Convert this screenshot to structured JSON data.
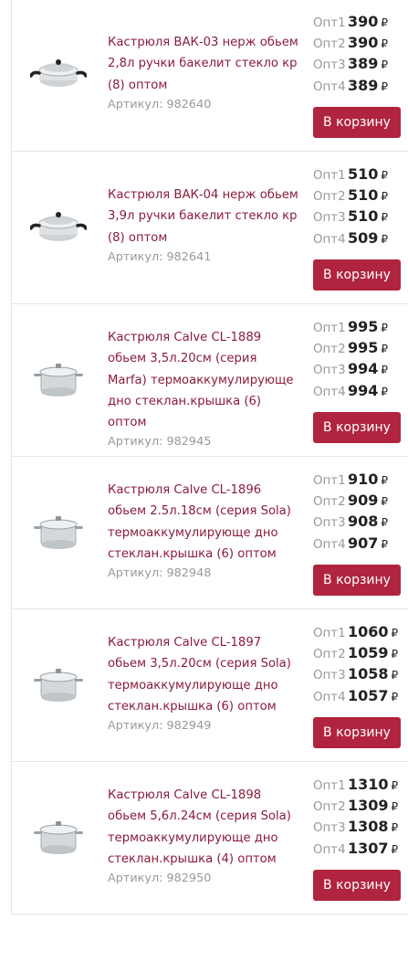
{
  "cart_label": "В корзину",
  "currency": "₽",
  "products": [
    {
      "title": "",
      "sku": "",
      "prices": [
        {
          "label": "",
          "value": ""
        },
        {
          "label": "",
          "value": ""
        },
        {
          "label": "",
          "value": ""
        },
        {
          "label": "",
          "value": ""
        }
      ]
    },
    {
      "title": "Кастрюля ВАК-03 нерж обьем 2,8л ручки бакелит стекло кр (8) оптом",
      "sku": "Артикул: 982640",
      "prices": [
        {
          "label": "Опт1",
          "value": "390"
        },
        {
          "label": "Опт2",
          "value": "390"
        },
        {
          "label": "Опт3",
          "value": "389"
        },
        {
          "label": "Опт4",
          "value": "389"
        }
      ]
    },
    {
      "title": "Кастрюля ВАК-04 нерж обьем 3,9л ручки бакелит стекло кр (8) оптом",
      "sku": "Артикул: 982641",
      "prices": [
        {
          "label": "Опт1",
          "value": "510"
        },
        {
          "label": "Опт2",
          "value": "510"
        },
        {
          "label": "Опт3",
          "value": "510"
        },
        {
          "label": "Опт4",
          "value": "509"
        }
      ]
    },
    {
      "title": "Кастрюля Calve CL-1889 обьем 3,5л.20см (серия Marfa) термоаккумулирующе дно стеклан.крышка (6) оптом",
      "sku": "Артикул: 982945",
      "prices": [
        {
          "label": "Опт1",
          "value": "995"
        },
        {
          "label": "Опт2",
          "value": "995"
        },
        {
          "label": "Опт3",
          "value": "994"
        },
        {
          "label": "Опт4",
          "value": "994"
        }
      ]
    },
    {
      "title": "Кастрюля Calve CL-1896 обьем 2.5л.18см (серия Sola) термоаккумулирующе дно стеклан.крышка (6) оптом",
      "sku": "Артикул: 982948",
      "prices": [
        {
          "label": "Опт1",
          "value": "910"
        },
        {
          "label": "Опт2",
          "value": "909"
        },
        {
          "label": "Опт3",
          "value": "908"
        },
        {
          "label": "Опт4",
          "value": "907"
        }
      ]
    },
    {
      "title": "Кастрюля Calve CL-1897 обьем 3,5л.20см (серия Sola) термоаккумулирующе дно стеклан.крышка (6) оптом",
      "sku": "Артикул: 982949",
      "prices": [
        {
          "label": "Опт1",
          "value": "1060"
        },
        {
          "label": "Опт2",
          "value": "1059"
        },
        {
          "label": "Опт3",
          "value": "1058"
        },
        {
          "label": "Опт4",
          "value": "1057"
        }
      ]
    },
    {
      "title": "Кастрюля Calve CL-1898 обьем 5,6л.24см (серия Sola) термоаккумулирующе дно стеклан.крышка (4) оптом",
      "sku": "Артикул: 982950",
      "prices": [
        {
          "label": "Опт1",
          "value": "1310"
        },
        {
          "label": "Опт2",
          "value": "1309"
        },
        {
          "label": "Опт3",
          "value": "1308"
        },
        {
          "label": "Опт4",
          "value": "1307"
        }
      ]
    }
  ]
}
